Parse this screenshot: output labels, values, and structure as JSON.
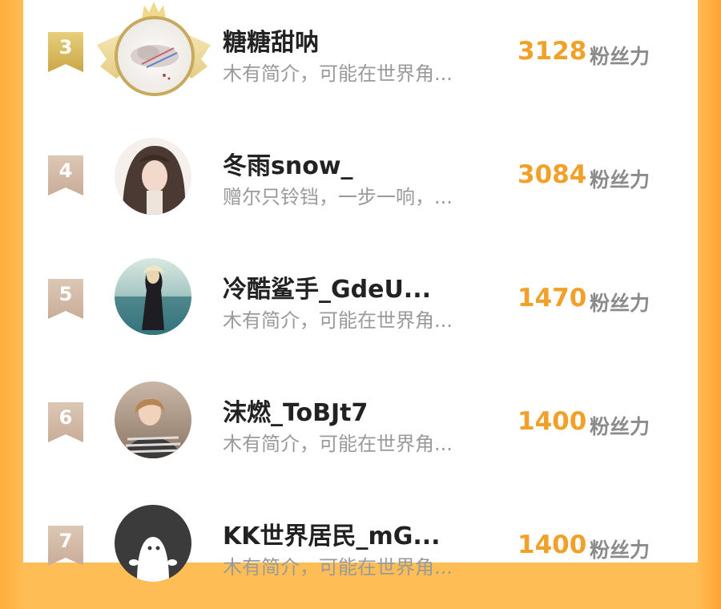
{
  "colors": {
    "background_orange": "#ffbe55",
    "score_orange": "#f1a129",
    "rank_gold": "#c9a747",
    "rank_plain": "#c9ad98"
  },
  "leaderboard": [
    {
      "rank": "3",
      "name": "糖糖甜呐",
      "bio": "木有简介，可能在世界角...",
      "score": "3128",
      "unit": "粉丝力",
      "avatar": "wing-cloud-artwork"
    },
    {
      "rank": "4",
      "name": "冬雨snow_",
      "bio": "赠尔只铃铛，一步一响，...",
      "score": "3084",
      "unit": "粉丝力",
      "avatar": "anime-girl-portrait"
    },
    {
      "rank": "5",
      "name": "冷酷鲨手_GdeU...",
      "bio": "木有简介，可能在世界角...",
      "score": "1470",
      "unit": "粉丝力",
      "avatar": "seaside-girl-photo"
    },
    {
      "rank": "6",
      "name": "沫燃_ToBJt7",
      "bio": "木有简介，可能在世界角...",
      "score": "1400",
      "unit": "粉丝力",
      "avatar": "striped-shirt-girl-photo"
    },
    {
      "rank": "7",
      "name": "KK世界居民_mG...",
      "bio": "木有简介，可能在世界角...",
      "score": "1400",
      "unit": "粉丝力",
      "avatar": "default-ghost-avatar"
    }
  ]
}
